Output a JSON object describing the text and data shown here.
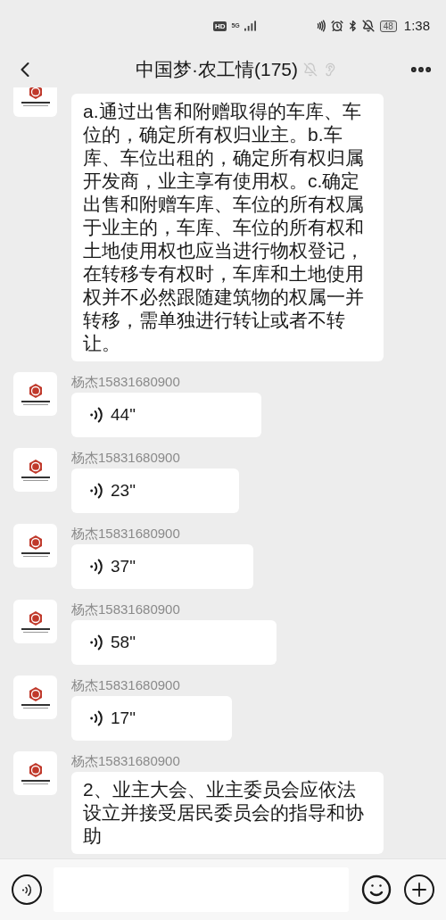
{
  "status_bar": {
    "network": [
      "HD",
      "5G"
    ],
    "battery": "48",
    "time": "1:38"
  },
  "header": {
    "title": "中国梦·农工情(175)"
  },
  "messages": [
    {
      "kind": "text",
      "text": "a.通过出售和附赠取得的车库、车位的，确定所有权归业主。b.车库、车位出租的，确定所有权归属开发商，业主享有使用权。c.确定出售和附赠车库、车位的所有权属于业主的，车库、车位的所有权和土地使用权也应当进行物权登记，在转移专有权时，车库和土地使用权并不必然跟随建筑物的权属一并转移，需单独进行转让或者不转让。"
    },
    {
      "kind": "voice",
      "sender": "杨杰15831680900",
      "duration": "44\""
    },
    {
      "kind": "voice",
      "sender": "杨杰15831680900",
      "duration": "23\""
    },
    {
      "kind": "voice",
      "sender": "杨杰15831680900",
      "duration": "37\""
    },
    {
      "kind": "voice",
      "sender": "杨杰15831680900",
      "duration": "58\""
    },
    {
      "kind": "voice",
      "sender": "杨杰15831680900",
      "duration": "17\""
    },
    {
      "kind": "text",
      "sender": "杨杰15831680900",
      "text": "2、业主大会、业主委员会应依法设立并接受居民委员会的指导和协助"
    }
  ]
}
